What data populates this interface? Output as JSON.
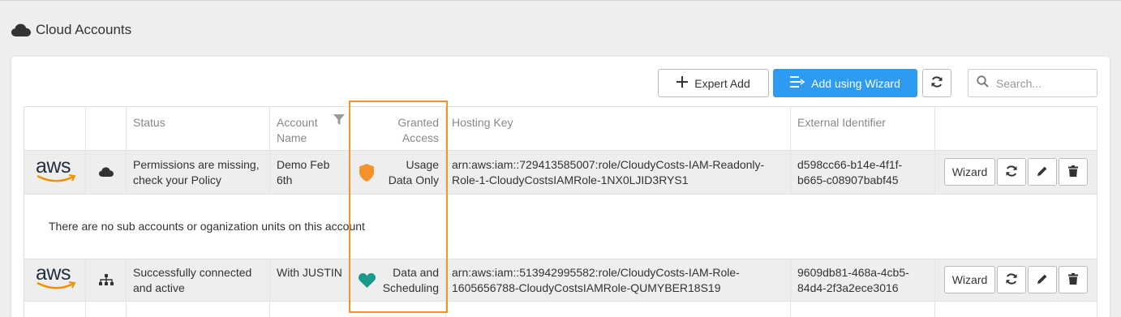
{
  "page": {
    "title": "Cloud Accounts"
  },
  "toolbar": {
    "expert_add_label": "Expert Add",
    "wizard_add_label": "Add using Wizard",
    "search_placeholder": "Search..."
  },
  "table": {
    "headers": {
      "status": "Status",
      "account_line1": "Account",
      "account_line2": "Name",
      "granted_line1": "Granted",
      "granted_line2": "Access",
      "hosting_key": "Hosting Key",
      "external_id": "External Identifier"
    },
    "rows": [
      {
        "provider_logo_text": "aws",
        "type_icon": "cloud-icon",
        "status_line1": "Permissions are missing,",
        "status_line2": "check your Policy",
        "account_line1": "Demo Feb",
        "account_line2": "6th",
        "access_icon": "shield-icon",
        "access_icon_color": "#f4922c",
        "access_line1": "Usage",
        "access_line2": "Data Only",
        "hosting_line1": "arn:aws:iam::729413585007:role/CloudyCosts-IAM-Readonly-",
        "hosting_line2": "Role-1-CloudyCostsIAMRole-1NX0LJID3RYS1",
        "external_line1": "d598cc66-b14e-4f1f-",
        "external_line2": "b665-c08907babf45",
        "wizard_label": "Wizard"
      },
      {
        "provider_logo_text": "aws",
        "type_icon": "org-tree-icon",
        "status_line1": "Successfully connected",
        "status_line2": "and active",
        "account_line1": "With JUSTIN",
        "account_line2": "",
        "access_icon": "heart-icon",
        "access_icon_color": "#1a9a8a",
        "access_line1": "Data and",
        "access_line2": "Scheduling",
        "hosting_line1": "arn:aws:iam::513942995582:role/CloudyCosts-IAM-Role-",
        "hosting_line2": "1605656788-CloudyCostsIAMRole-QUMYBER18S19",
        "external_line1": "9609db81-468a-4cb5-",
        "external_line2": "84d4-2f3a2ece3016",
        "wizard_label": "Wizard"
      }
    ],
    "sub_message": "There are no sub accounts or oganization units on this account"
  },
  "colors": {
    "accent": "#2d9bf0",
    "highlight": "#f4922c",
    "aws_smile": "#f29100"
  }
}
